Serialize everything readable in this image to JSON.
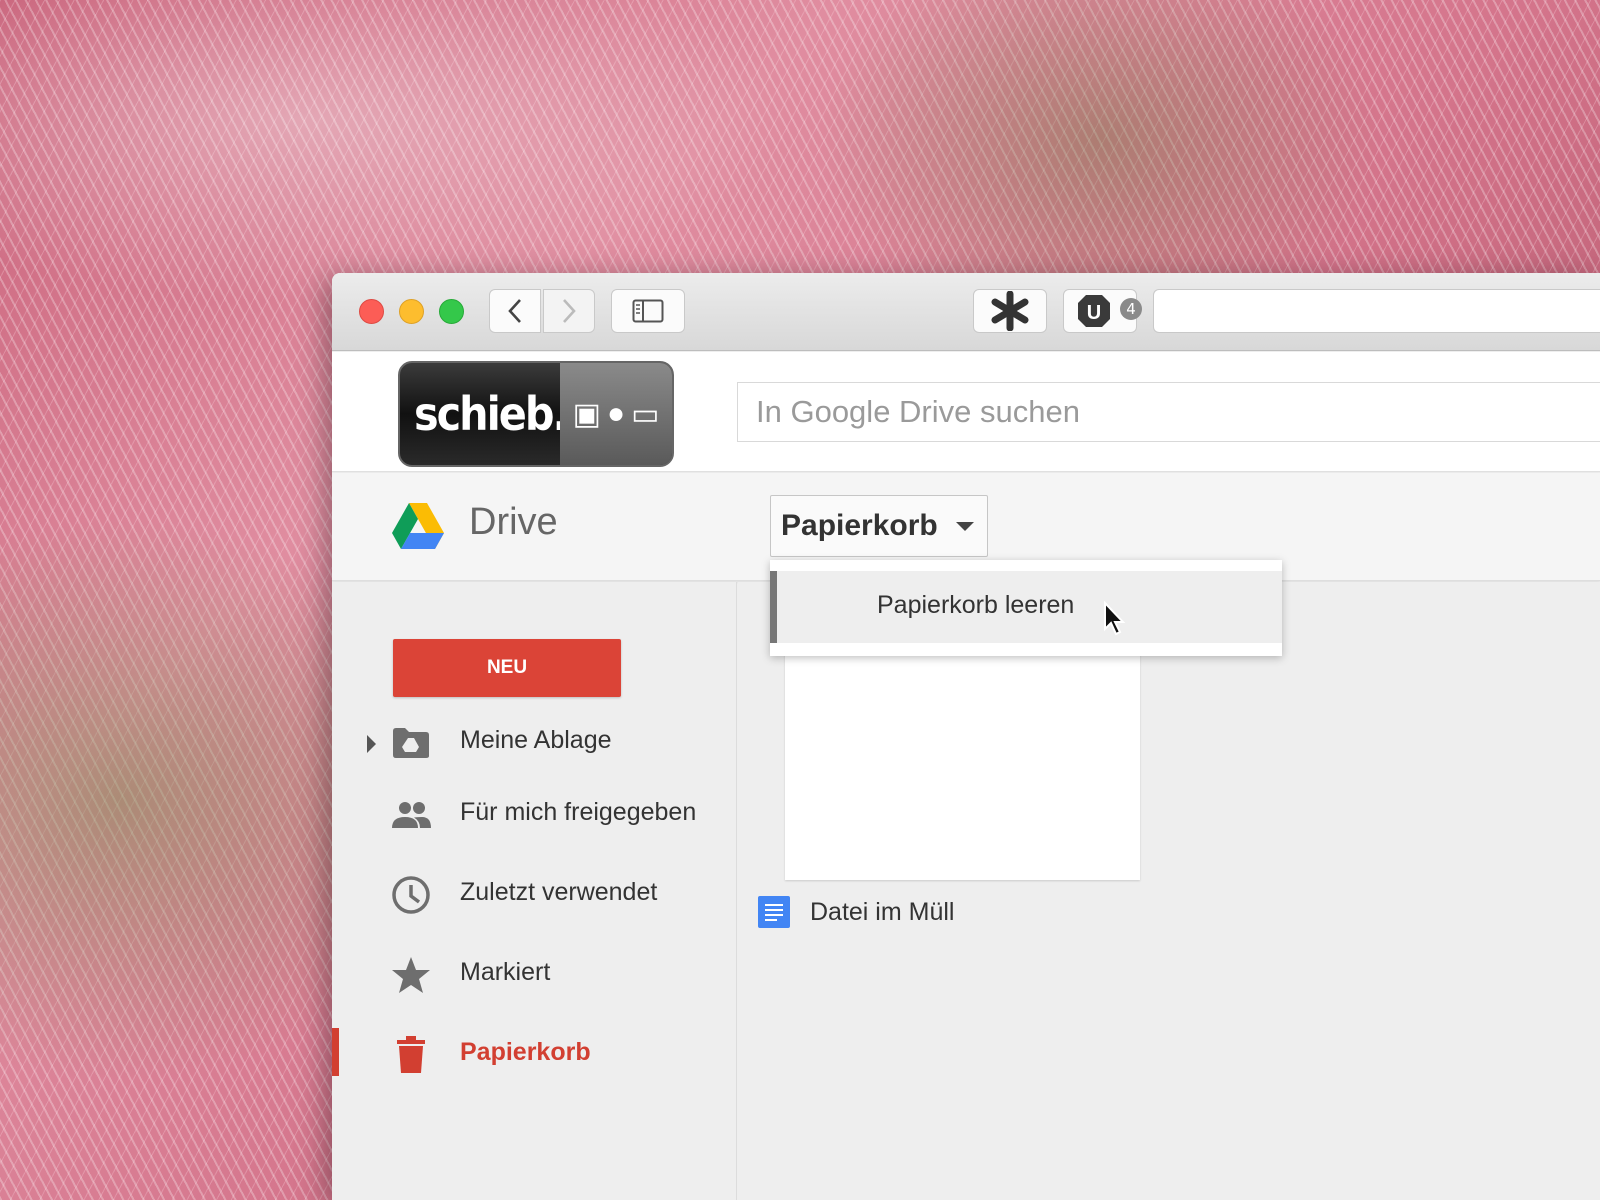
{
  "logo": {
    "brand": "schieb.de"
  },
  "header": {
    "search_placeholder": "In Google Drive suchen"
  },
  "titlebar": {
    "extension_badge_count": "4"
  },
  "drive": {
    "title": "Drive",
    "current_folder": "Papierkorb",
    "menu": {
      "items": [
        {
          "label": "Papierkorb leeren"
        }
      ]
    }
  },
  "sidebar": {
    "new_button": "NEU",
    "items": [
      {
        "label": "Meine Ablage",
        "icon": "drive-folder-icon"
      },
      {
        "label": "Für mich freigegeben",
        "icon": "people-icon"
      },
      {
        "label": "Zuletzt verwendet",
        "icon": "clock-icon"
      },
      {
        "label": "Markiert",
        "icon": "star-icon"
      },
      {
        "label": "Papierkorb",
        "icon": "trash-icon",
        "active": true
      }
    ]
  },
  "files": [
    {
      "name": "Datei im Müll",
      "icon": "doc-icon"
    }
  ],
  "colors": {
    "accent": "#db4437",
    "active": "#d23f31",
    "doc_blue": "#4285f4"
  }
}
